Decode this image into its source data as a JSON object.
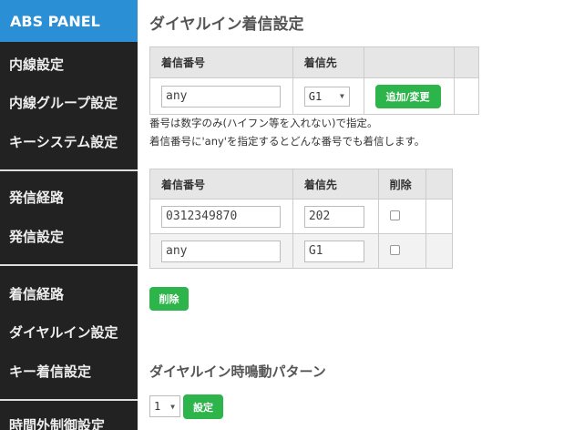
{
  "sidebar": {
    "brand": "ABS PANEL",
    "items": [
      "内線設定",
      "内線グループ設定",
      "キーシステム設定",
      "発信経路",
      "発信設定",
      "着信経路",
      "ダイヤルイン設定",
      "キー着信設定",
      "時間外制御設定"
    ]
  },
  "main": {
    "title": "ダイヤルイン着信設定",
    "add_form": {
      "col_number": "着信番号",
      "col_dest": "着信先",
      "number_value": "any",
      "dest_value": "G1",
      "add_button": "追加/変更"
    },
    "help_lines": [
      "番号は数字のみ(ハイフン等を入れない)で指定。",
      "着信番号に'any'を指定するとどんな番号でも着信します。"
    ],
    "list": {
      "col_number": "着信番号",
      "col_dest": "着信先",
      "col_delete": "削除",
      "rows": [
        {
          "number": "0312349870",
          "dest": "202"
        },
        {
          "number": "any",
          "dest": "G1"
        }
      ],
      "delete_button": "削除"
    },
    "pattern": {
      "title": "ダイヤルイン時鳴動パターン",
      "select_value": "1",
      "set_button": "設定"
    }
  }
}
